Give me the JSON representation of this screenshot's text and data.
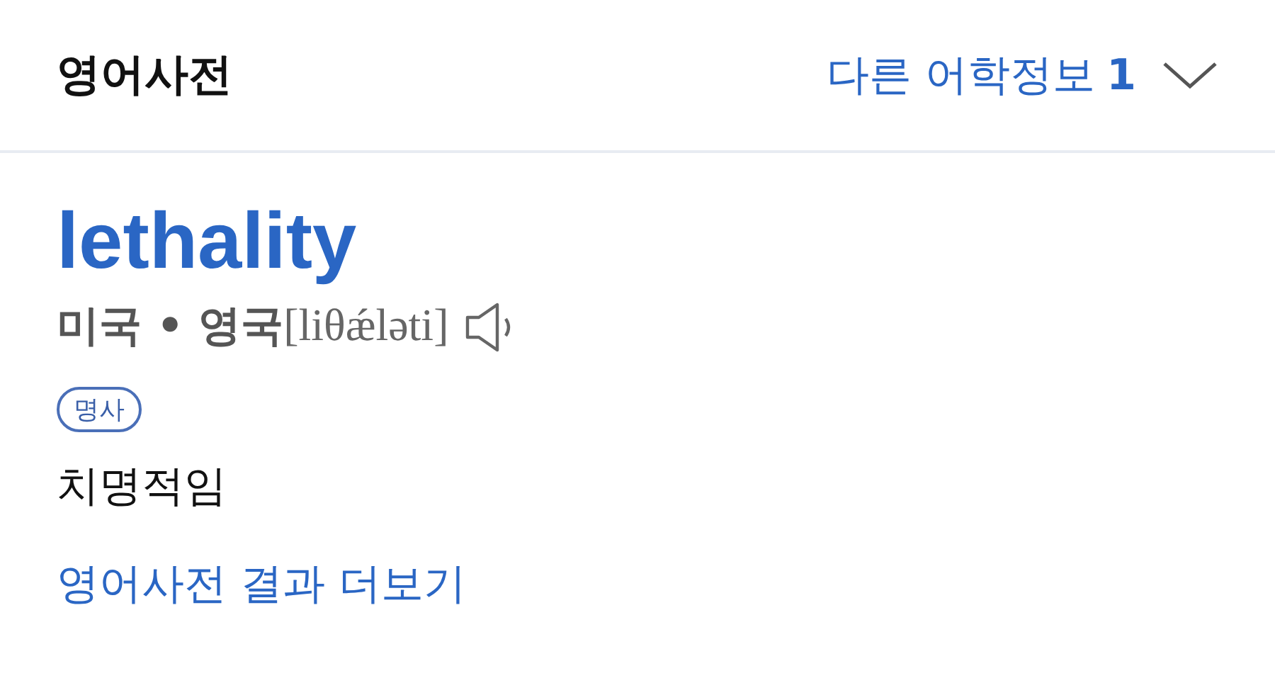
{
  "header": {
    "title": "영어사전",
    "other_info": {
      "label": "다른 어학정보",
      "count": "1",
      "expanded": false
    }
  },
  "entry": {
    "word": "lethality",
    "region": "미국",
    "separator": "•",
    "region_2": "영국",
    "pronunciation": "[liθǽləti]",
    "part_of_speech": "명사",
    "meaning": "치명적임"
  },
  "more_link": "영어사전 결과 더보기"
}
